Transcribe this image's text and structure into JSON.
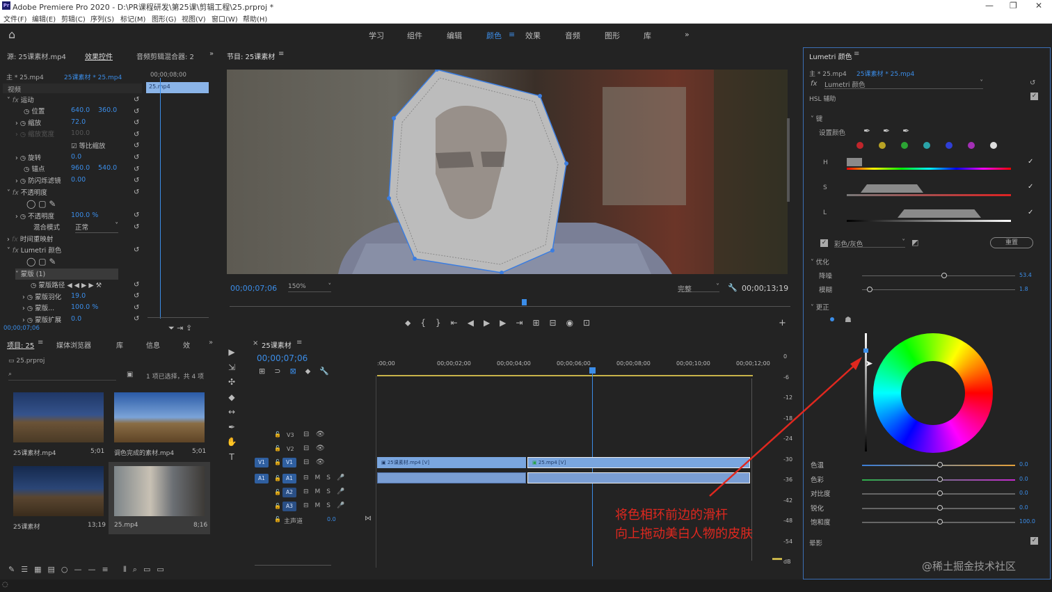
{
  "window": {
    "title": "Adobe Premiere Pro 2020 - D:\\PR课程研发\\第25课\\剪辑工程\\25.prproj *",
    "logo": "Pr"
  },
  "menu": [
    "文件(F)",
    "编辑(E)",
    "剪辑(C)",
    "序列(S)",
    "标记(M)",
    "图形(G)",
    "视图(V)",
    "窗口(W)",
    "帮助(H)"
  ],
  "workspaces": [
    "学习",
    "组件",
    "编辑",
    "颜色",
    "效果",
    "音频",
    "图形",
    "库"
  ],
  "active_workspace": "颜色",
  "effect_controls": {
    "tabs": [
      "源: 25课素材.mp4",
      "效果控件",
      "音频剪辑混合器: 2"
    ],
    "master": "主 * 25.mp4",
    "clip": "25课素材 * 25.mp4",
    "tc": "00;00;08;00",
    "clip_bar": "25.mp4",
    "section_video": "视频",
    "rows": [
      {
        "label": "运动"
      },
      {
        "label": "位置",
        "v1": "640.0",
        "v2": "360.0"
      },
      {
        "label": "缩放",
        "v1": "72.0"
      },
      {
        "label": "缩放宽度",
        "v1": "100.0"
      },
      {
        "label": "等比缩放"
      },
      {
        "label": "旋转",
        "v1": "0.0"
      },
      {
        "label": "锚点",
        "v1": "960.0",
        "v2": "540.0"
      },
      {
        "label": "防闪烁滤镜",
        "v1": "0.00"
      },
      {
        "label": "不透明度"
      },
      {
        "label": "不透明度",
        "v1": "100.0 %"
      },
      {
        "label": "混合模式",
        "v1": "正常"
      },
      {
        "label": "时间重映射"
      },
      {
        "label": "Lumetri 颜色"
      },
      {
        "label": "蒙版 (1)"
      },
      {
        "label": "蒙版路径"
      },
      {
        "label": "蒙版羽化",
        "v1": "19.0"
      },
      {
        "label": "蒙版...",
        "v1": "100.0 %"
      },
      {
        "label": "蒙版扩展",
        "v1": "0.0"
      }
    ],
    "footer_tc": "00;00;07;06"
  },
  "program": {
    "title": "节目: 25课素材",
    "tc": "00;00;07;06",
    "zoom": "150%",
    "quality": "完整",
    "duration": "00;00;13;19"
  },
  "project": {
    "tabs": [
      "项目: 25",
      "媒体浏览器",
      "库",
      "信息",
      "效"
    ],
    "file": "25.prproj",
    "status": "1 项已选择，共 4 项",
    "items": [
      {
        "name": "25课素材.mp4",
        "dur": "5;01"
      },
      {
        "name": "调色完成的素材.mp4",
        "dur": "5;01"
      },
      {
        "name": "25课素材",
        "dur": "13;19"
      },
      {
        "name": "25.mp4",
        "dur": "8;16"
      }
    ]
  },
  "timeline": {
    "title": "25课素材",
    "tc": "00;00;07;06",
    "ruler": [
      ":00;00",
      "00;00;02;00",
      "00;00;04;00",
      "00;00;06;00",
      "00;00;08;00",
      "00;00;10;00",
      "00;00;12;00"
    ],
    "tracks": [
      "V3",
      "V2",
      "V1",
      "A1",
      "A2",
      "A3"
    ],
    "master": "主声道",
    "master_val": "0.0",
    "clip1": "25课素材.mp4 [V]",
    "clip2": "25.mp4 [V]",
    "meter": [
      "0",
      "-6",
      "-12",
      "-18",
      "-24",
      "-30",
      "-36",
      "-42",
      "-48",
      "-54",
      "dB"
    ]
  },
  "lumetri": {
    "title": "Lumetri 颜色",
    "master": "主 * 25.mp4",
    "clip": "25课素材 * 25.mp4",
    "fx": "Lumetri 颜色",
    "hsl": "HSL 辅助",
    "key": "键",
    "set_color": "设置颜色",
    "h": "H",
    "s": "S",
    "l": "L",
    "color_gray": "彩色/灰色",
    "reset": "重置",
    "refine": "优化",
    "denoise": "降噪",
    "denoise_val": "53.4",
    "blur": "模糊",
    "blur_val": "1.8",
    "correct": "更正",
    "sliders": [
      {
        "label": "色温",
        "val": "0.0"
      },
      {
        "label": "色彩",
        "val": "0.0"
      },
      {
        "label": "对比度",
        "val": "0.0"
      },
      {
        "label": "锐化",
        "val": "0.0"
      },
      {
        "label": "饱和度",
        "val": "100.0"
      }
    ],
    "vignette": "晕影",
    "swatches": [
      "#c0252b",
      "#b9a324",
      "#2ca334",
      "#2aa3a8",
      "#2f3fd6",
      "#a32fb5",
      "#dddddd"
    ]
  },
  "annotation": [
    "将色相环前边的滑杆",
    "向上拖动美白人物的皮肤"
  ],
  "watermark": "@稀土掘金技术社区"
}
